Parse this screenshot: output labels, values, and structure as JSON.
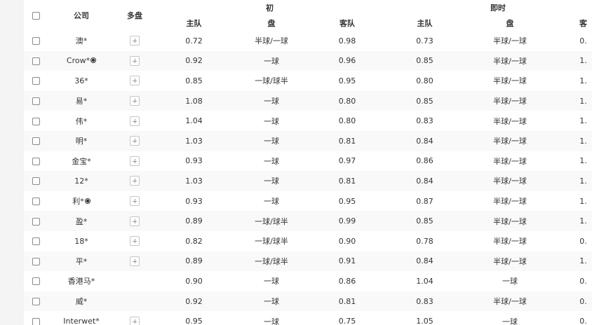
{
  "header": {
    "company": "公司",
    "multi": "多盘",
    "early_group": "初",
    "live_group": "即时",
    "early_home": "主队",
    "early_line": "盘",
    "early_away": "客队",
    "live_home": "主队",
    "live_line": "盘",
    "live_away": "客"
  },
  "rows": [
    {
      "company": "澳*",
      "ball": false,
      "multi": true,
      "e_home": "0.72",
      "e_line": "半球/一球",
      "e_away": "0.98",
      "l_home": "0.73",
      "l_line": "半球/一球",
      "l_away": "0."
    },
    {
      "company": "Crow*",
      "ball": true,
      "multi": true,
      "e_home": "0.92",
      "e_line": "一球",
      "e_away": "0.96",
      "l_home": "0.85",
      "l_line": "半球/一球",
      "l_away": "1."
    },
    {
      "company": "36*",
      "ball": false,
      "multi": true,
      "e_home": "0.85",
      "e_line": "一球/球半",
      "e_away": "0.95",
      "l_home": "0.80",
      "l_line": "半球/一球",
      "l_away": "1."
    },
    {
      "company": "易*",
      "ball": false,
      "multi": true,
      "e_home": "1.08",
      "e_line": "一球",
      "e_away": "0.80",
      "l_home": "0.85",
      "l_line": "半球/一球",
      "l_away": "1."
    },
    {
      "company": "伟*",
      "ball": false,
      "multi": true,
      "e_home": "1.04",
      "e_line": "一球",
      "e_away": "0.80",
      "l_home": "0.83",
      "l_line": "半球/一球",
      "l_away": "1."
    },
    {
      "company": "明*",
      "ball": false,
      "multi": true,
      "e_home": "1.03",
      "e_line": "一球",
      "e_away": "0.81",
      "l_home": "0.84",
      "l_line": "半球/一球",
      "l_away": "1."
    },
    {
      "company": "金宝*",
      "ball": false,
      "multi": true,
      "e_home": "0.93",
      "e_line": "一球",
      "e_away": "0.97",
      "l_home": "0.86",
      "l_line": "半球/一球",
      "l_away": "1."
    },
    {
      "company": "12*",
      "ball": false,
      "multi": true,
      "e_home": "1.03",
      "e_line": "一球",
      "e_away": "0.81",
      "l_home": "0.84",
      "l_line": "半球/一球",
      "l_away": "1."
    },
    {
      "company": "利*",
      "ball": true,
      "multi": true,
      "e_home": "0.93",
      "e_line": "一球",
      "e_away": "0.95",
      "l_home": "0.87",
      "l_line": "半球/一球",
      "l_away": "1."
    },
    {
      "company": "盈*",
      "ball": false,
      "multi": true,
      "e_home": "0.89",
      "e_line": "一球/球半",
      "e_away": "0.99",
      "l_home": "0.85",
      "l_line": "半球/一球",
      "l_away": "1."
    },
    {
      "company": "18*",
      "ball": false,
      "multi": true,
      "e_home": "0.82",
      "e_line": "一球/球半",
      "e_away": "0.90",
      "l_home": "0.78",
      "l_line": "半球/一球",
      "l_away": "0."
    },
    {
      "company": "平*",
      "ball": false,
      "multi": true,
      "e_home": "0.89",
      "e_line": "一球/球半",
      "e_away": "0.91",
      "l_home": "0.84",
      "l_line": "半球/一球",
      "l_away": "1."
    },
    {
      "company": "香港马*",
      "ball": false,
      "multi": false,
      "e_home": "0.90",
      "e_line": "一球",
      "e_away": "0.86",
      "l_home": "1.04",
      "l_line": "一球",
      "l_away": "0."
    },
    {
      "company": "威*",
      "ball": false,
      "multi": false,
      "e_home": "0.92",
      "e_line": "一球",
      "e_away": "0.81",
      "l_home": "0.83",
      "l_line": "半球/一球",
      "l_away": "0."
    },
    {
      "company": "Interwet*",
      "ball": false,
      "multi": true,
      "e_home": "0.95",
      "e_line": "一球",
      "e_away": "0.75",
      "l_home": "1.05",
      "l_line": "一球",
      "l_away": "0."
    }
  ]
}
